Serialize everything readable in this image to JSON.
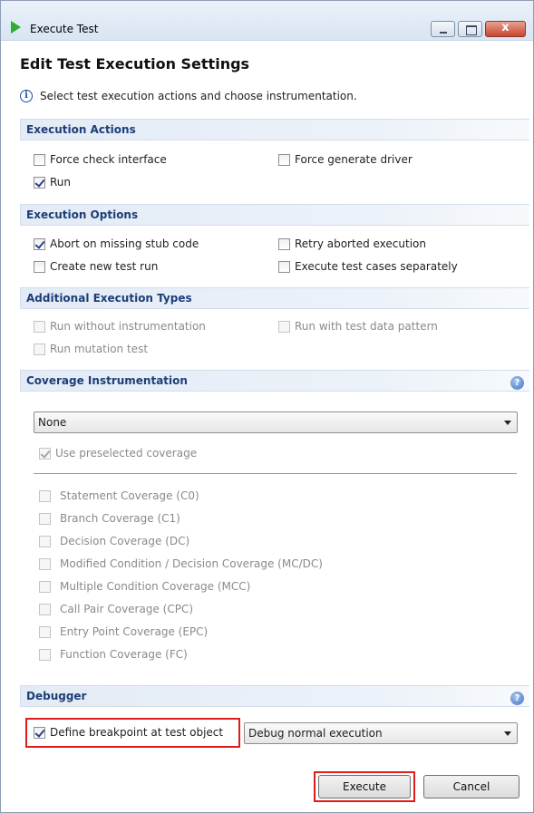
{
  "window": {
    "title": "Execute Test",
    "close_glyph": "x"
  },
  "header": {
    "heading": "Edit Test Execution Settings",
    "info_icon": "info-icon",
    "info_glyph": "i",
    "info_text": "Select test execution actions and choose instrumentation."
  },
  "sections": {
    "execution_actions": {
      "title": "Execution Actions",
      "force_check_interface": {
        "label": "Force check interface",
        "checked": false
      },
      "force_generate_driver": {
        "label": "Force generate driver",
        "checked": false
      },
      "run": {
        "label": "Run",
        "checked": true
      }
    },
    "execution_options": {
      "title": "Execution Options",
      "abort_on_missing_stub": {
        "label": "Abort on missing stub code",
        "checked": true
      },
      "retry_aborted": {
        "label": "Retry aborted execution",
        "checked": false
      },
      "create_new_test_run": {
        "label": "Create new test run",
        "checked": false
      },
      "execute_separately": {
        "label": "Execute test cases separately",
        "checked": false
      }
    },
    "additional_types": {
      "title": "Additional Execution Types",
      "run_without_instrumentation": {
        "label": "Run without instrumentation",
        "checked": false,
        "enabled": false
      },
      "run_with_test_data_pattern": {
        "label": "Run with test data pattern",
        "checked": false,
        "enabled": false
      },
      "run_mutation_test": {
        "label": "Run mutation test",
        "checked": false,
        "enabled": false
      }
    },
    "coverage": {
      "title": "Coverage Instrumentation",
      "help_glyph": "?",
      "selected": "None",
      "use_preselected": {
        "label": "Use preselected coverage",
        "checked": true,
        "enabled": false
      },
      "items": [
        {
          "label": "Statement Coverage (C0)",
          "checked": false,
          "enabled": false
        },
        {
          "label": "Branch Coverage (C1)",
          "checked": false,
          "enabled": false
        },
        {
          "label": "Decision Coverage (DC)",
          "checked": false,
          "enabled": false
        },
        {
          "label": "Modified Condition / Decision Coverage (MC/DC)",
          "checked": false,
          "enabled": false
        },
        {
          "label": "Multiple Condition Coverage (MCC)",
          "checked": false,
          "enabled": false
        },
        {
          "label": "Call Pair Coverage (CPC)",
          "checked": false,
          "enabled": false
        },
        {
          "label": "Entry Point Coverage (EPC)",
          "checked": false,
          "enabled": false
        },
        {
          "label": "Function Coverage (FC)",
          "checked": false,
          "enabled": false
        }
      ]
    },
    "debugger": {
      "title": "Debugger",
      "help_glyph": "?",
      "define_breakpoint": {
        "label": "Define breakpoint at test object",
        "checked": true
      },
      "mode_selected": "Debug normal execution"
    }
  },
  "footer": {
    "execute_label": "Execute",
    "cancel_label": "Cancel"
  },
  "colors": {
    "highlight": "#e01b1b",
    "section_title": "#1d3e78",
    "run_icon": "#2fae2f"
  }
}
